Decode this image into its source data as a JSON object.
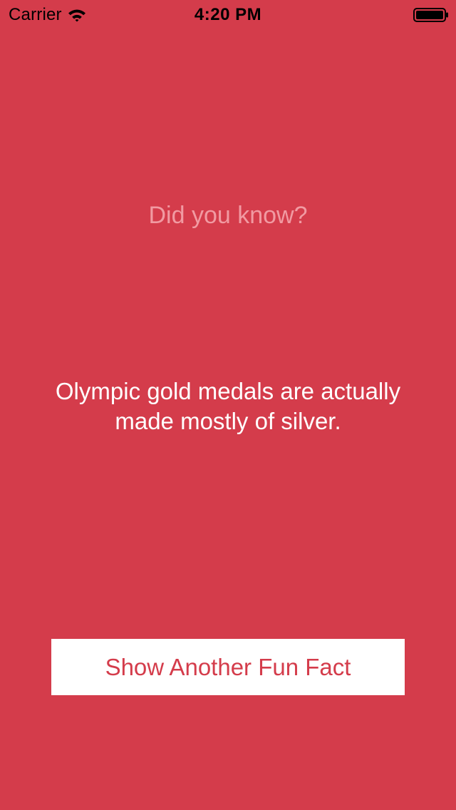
{
  "status_bar": {
    "carrier": "Carrier",
    "time": "4:20 PM",
    "icons": [
      "wifi-icon",
      "battery-icon"
    ]
  },
  "content": {
    "heading": "Did you know?",
    "fact": "Olympic gold medals are actually made mostly of silver.",
    "button_label": "Show Another Fun Fact"
  },
  "colors": {
    "background": "#d43c4b",
    "heading_text": "#f19aa2",
    "fact_text": "#ffffff",
    "button_background": "#ffffff",
    "button_text": "#d43c4b"
  }
}
